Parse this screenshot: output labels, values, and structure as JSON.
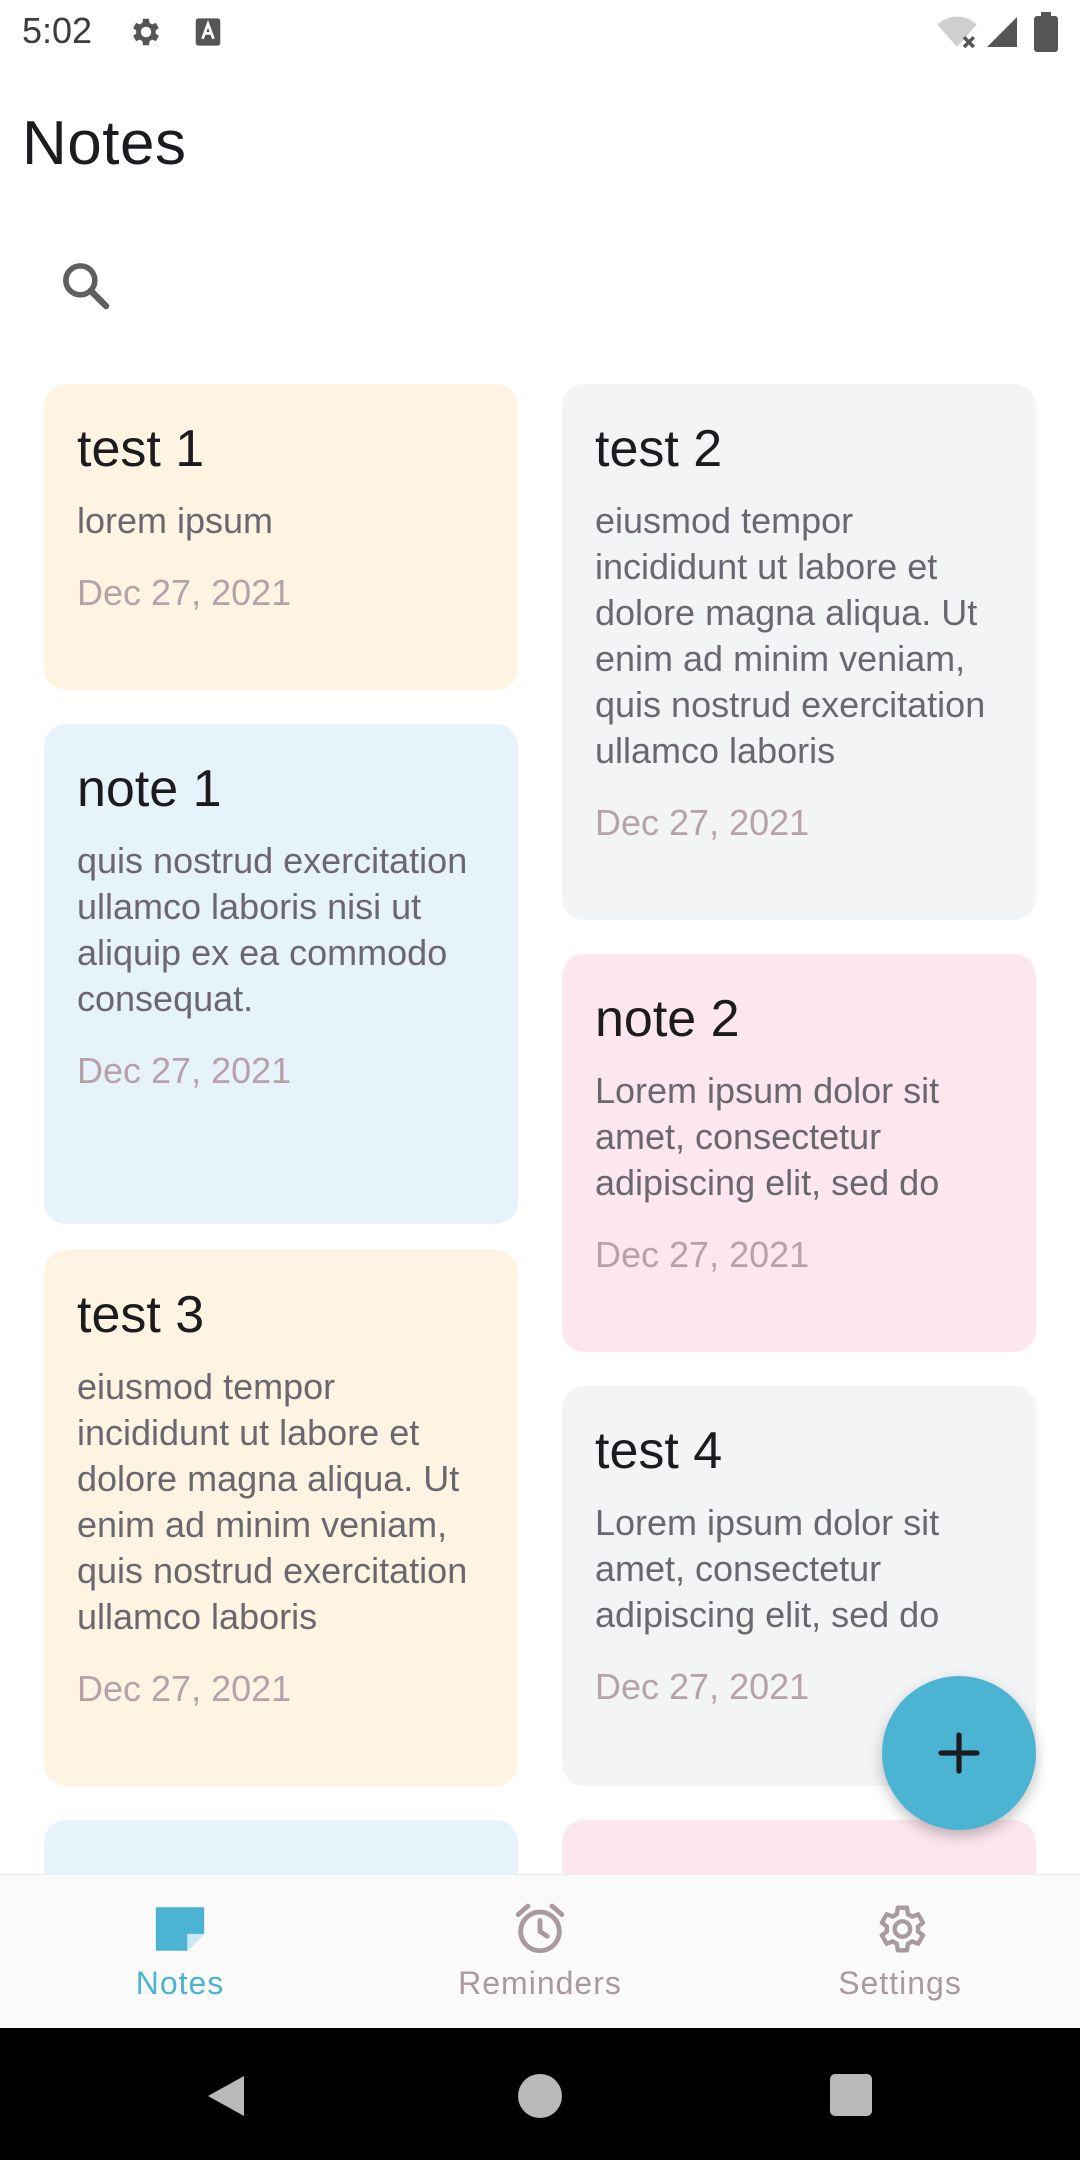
{
  "status_bar": {
    "time": "5:02",
    "icons": [
      "gear-icon",
      "font-a-icon",
      "wifi-off-icon",
      "signal-icon",
      "battery-icon"
    ]
  },
  "header": {
    "title": "Notes",
    "search_icon": "search-icon"
  },
  "notes": [
    {
      "title": "test 1",
      "body": "lorem ipsum",
      "date": "Dec 27, 2021",
      "color": "#fef4e1"
    },
    {
      "title": "test 2",
      "body": "eiusmod tempor incididunt ut labore et dolore magna aliqua. Ut enim ad minim veniam, quis nostrud exercitation ullamco laboris",
      "date": "Dec 27, 2021",
      "color": "#f3f4f6"
    },
    {
      "title": "note 1",
      "body": "quis nostrud exercitation ullamco laboris nisi ut aliquip ex ea commodo consequat.",
      "date": "Dec 27, 2021",
      "color": "#e7f3fb"
    },
    {
      "title": "note 2",
      "body": "Lorem ipsum dolor sit amet, consectetur adipiscing elit, sed do",
      "date": "Dec 27, 2021",
      "color": "#fde7ef"
    },
    {
      "title": "test 3",
      "body": "eiusmod tempor incididunt ut labore et dolore magna aliqua. Ut enim ad minim veniam, quis nostrud exercitation ullamco laboris",
      "date": "Dec 27, 2021",
      "color": "#fef4e1"
    },
    {
      "title": "test 4",
      "body": "Lorem ipsum dolor sit amet, consectetur adipiscing elit, sed do",
      "date": "Dec 27, 2021",
      "color": "#f3f4f6"
    },
    {
      "title": "",
      "body": "",
      "date": "",
      "color": "#e7f3fb"
    },
    {
      "title": "",
      "body": "",
      "date": "",
      "color": "#fde7ef"
    }
  ],
  "fab": {
    "icon": "plus-icon"
  },
  "bottom_nav": {
    "active_color": "#4bb4d3",
    "inactive_color": "#a89aa0",
    "items": [
      {
        "label": "Notes",
        "icon": "note-icon",
        "active": true
      },
      {
        "label": "Reminders",
        "icon": "alarm-clock-icon",
        "active": false
      },
      {
        "label": "Settings",
        "icon": "gear-icon",
        "active": false
      }
    ]
  },
  "system_nav": {
    "buttons": [
      "back-icon",
      "home-icon",
      "recents-icon"
    ]
  }
}
